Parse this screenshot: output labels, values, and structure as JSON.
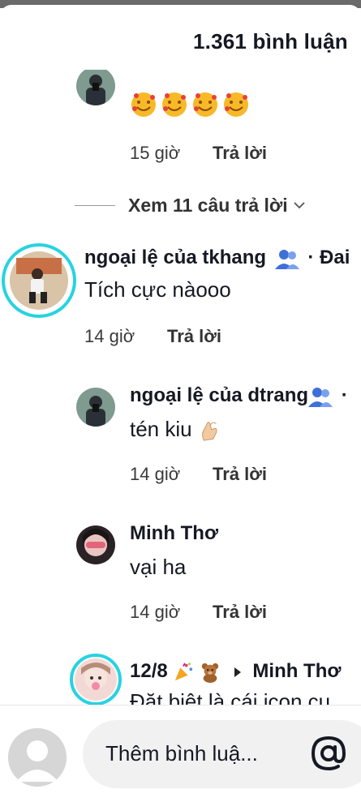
{
  "header": {
    "title": "1.361 bình luận"
  },
  "comments": [
    {
      "emoji_count": 4,
      "time": "15 giờ",
      "reply_label": "Trả lời",
      "view_replies": "Xem 11 câu trả lời"
    },
    {
      "name": "ngoại lệ của tkhang",
      "name_suffix": "· Đai",
      "text": "Tích cực nàooo",
      "time": "14 giờ",
      "reply_label": "Trả lời"
    },
    {
      "name": "ngoại lệ của dtrang",
      "name_suffix": "·",
      "text": "tén kiu",
      "time": "14 giờ",
      "reply_label": "Trả lời"
    },
    {
      "name": "Minh Thơ",
      "text": "vại ha",
      "time": "14 giờ",
      "reply_label": "Trả lời"
    },
    {
      "name": "12/8",
      "reply_to": "Minh Thơ",
      "text": "Đặt biệt là cái icon cu"
    }
  ],
  "composer": {
    "placeholder": "Thêm bình luậ..."
  },
  "icons": {
    "friends": "friends-icon",
    "chevron": "chevron-down-icon",
    "mention": "at-icon",
    "heart_face": "smiling-face-with-hearts-emoji",
    "finger_heart": "finger-heart-emoji",
    "party": "party-popper-emoji",
    "bear": "teddy-bear-emoji",
    "caret": "caret-right-icon"
  },
  "colors": {
    "accent_ring": "#27d3e0",
    "text": "#161823",
    "friends_icon": "#3f6fd8"
  }
}
